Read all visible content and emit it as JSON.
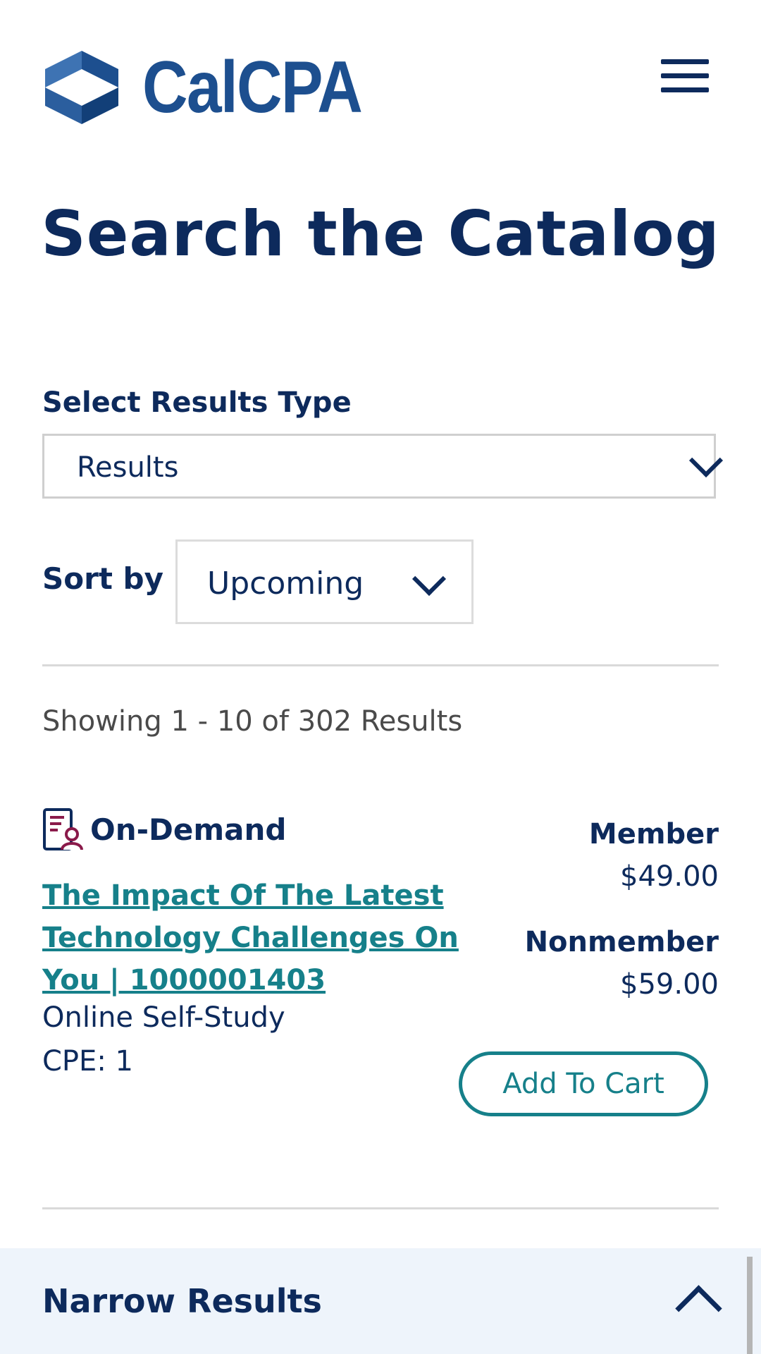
{
  "header": {
    "logo_text": "CalCPA",
    "menu_icon": "hamburger-menu-icon"
  },
  "page": {
    "title": "Search the Catalog"
  },
  "filters": {
    "results_type_label": "Select Results Type",
    "results_type_value": "Results",
    "sort_label": "Sort by",
    "sort_value": "Upcoming"
  },
  "results": {
    "showing_text": "Showing 1 - 10 of 302 Results",
    "items": [
      {
        "type_icon": "on-demand-certificate-icon",
        "type_label": "On-Demand",
        "title": "The Impact Of The Latest Technology Challenges On You | 1000001403",
        "format": "Online Self-Study",
        "cpe": "CPE: 1",
        "member_label": "Member",
        "member_price": "$49.00",
        "nonmember_label": "Nonmember",
        "nonmember_price": "$59.00",
        "cart_label": "Add To Cart"
      }
    ]
  },
  "narrow": {
    "title": "Narrow Results",
    "expanded_icon": "chevron-up-icon"
  },
  "colors": {
    "navy": "#0d2a5c",
    "logo_blue": "#1d4f8f",
    "teal": "#16808a",
    "icon_magenta": "#8a1a4a",
    "narrow_bg": "#eef4fb"
  }
}
